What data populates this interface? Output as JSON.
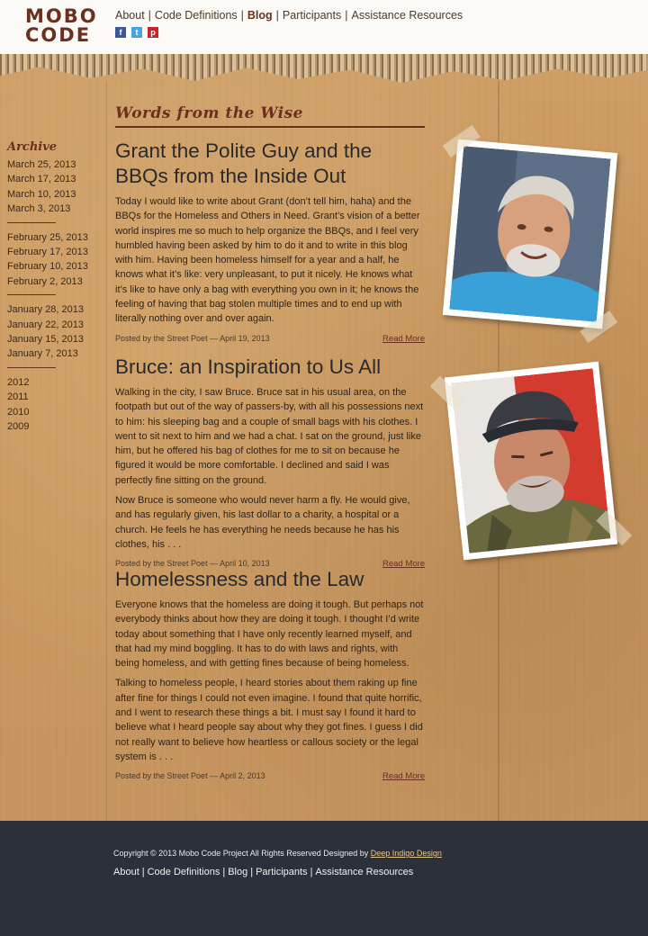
{
  "logo": {
    "line1": "MOBO",
    "line2": "CODE"
  },
  "nav": {
    "items": [
      "About",
      "Code Definitions",
      "Blog",
      "Participants",
      "Assistance Resources"
    ],
    "active": "Blog"
  },
  "social": {
    "facebook": "f",
    "twitter": "t",
    "pinterest": "p"
  },
  "section_heading": "Words from the Wise",
  "archive": {
    "title": "Archive",
    "groups": [
      [
        "March 25, 2013",
        "March 17, 2013",
        "March 10, 2013",
        "March 3, 2013"
      ],
      [
        "February 25, 2013",
        "February 17, 2013",
        "February 10, 2013",
        "February 2, 2013"
      ],
      [
        "January 28, 2013",
        "January 22, 2013",
        "January 15, 2013",
        "January 7, 2013"
      ],
      [
        "2012",
        "2011",
        "2010",
        "2009"
      ]
    ]
  },
  "posts": [
    {
      "title": "Grant the Polite Guy and the BBQs from the Inside Out",
      "paragraphs": [
        "Today I would like to write about Grant (don’t tell him, haha) and the BBQs for the Homeless and Others in Need. Grant’s vision of a better world inspires me so much to help organize the BBQs, and I feel very humbled having been asked by him to do it and to write in this blog with him. Having been homeless himself for a year and a half, he knows what it’s like: very unpleasant, to put it nicely. He knows what it’s like to have only a bag with everything you own in it; he knows the feeling of having that bag stolen multiple times and to end up with literally nothing over and over again."
      ],
      "meta": "Posted by the Street Poet — April 19, 2013",
      "read_more": "Read More"
    },
    {
      "title": "Bruce: an Inspiration to Us All",
      "paragraphs": [
        "Walking in the city, I saw Bruce. Bruce sat in his usual area, on the footpath but out of the way of passers-by, with all his possessions next to him: his sleeping bag and a couple of small bags with his clothes. I went to sit next to him and we had a chat. I sat on the ground, just like him, but he offered his bag of clothes for me to sit on because he figured it would be more comfortable. I declined and said I was perfectly fine sitting on the ground.",
        "Now Bruce is someone who would never harm a fly. He would give, and has regularly given, his last dollar to a charity, a hospital or a church. He feels he has everything he needs because he has his clothes, his . . ."
      ],
      "meta": "Posted by the Street Poet — April 10, 2013",
      "read_more": "Read More"
    },
    {
      "title": "Homelessness and the Law",
      "paragraphs": [
        "Everyone knows that the homeless are doing it tough. But perhaps not everybody thinks about how they are doing it tough. I thought I’d write today about something that I have only recently learned myself, and that had my mind boggling. It has to do with laws and rights, with being homeless, and with getting fines because of being homeless.",
        "Talking to homeless people, I heard stories about them raking up fine after fine for things I could not even imagine. I found that quite horrific, and I went to research these things a bit. I must say I found it hard to believe what I heard people say about why they got fines. I guess I did not really want to believe how heartless or callous society or the legal system is . . ."
      ],
      "meta": "Posted by the Street Poet — April 2, 2013",
      "read_more": "Read More"
    }
  ],
  "footer": {
    "copyright": "Copyright © 2013 Mobo Code Project   All Rights Reserved   Designed by ",
    "designer": "Deep Indigo Design",
    "nav": [
      "About",
      "Code Definitions",
      "Blog",
      "Participants",
      "Assistance Resources"
    ]
  },
  "colors": {
    "brand": "#6b2e1f",
    "footer_bg": "#2b313b",
    "cardboard": "#c89a63"
  }
}
